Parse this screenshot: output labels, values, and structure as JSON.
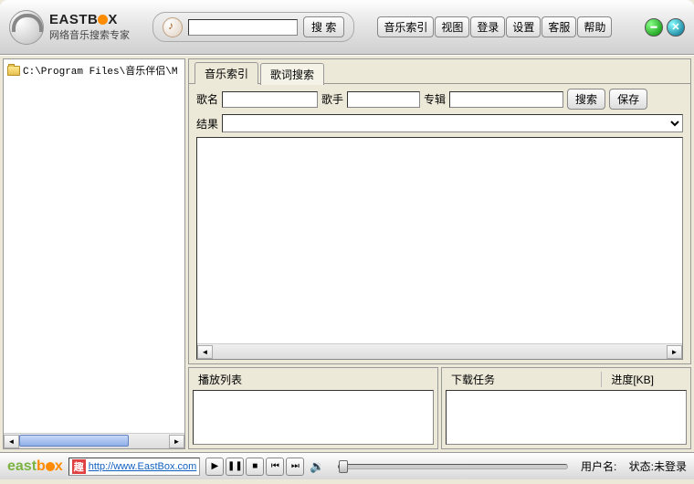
{
  "header": {
    "brand_prefix": "EASTB",
    "brand_suffix": "X",
    "subtitle": "网络音乐搜索专家",
    "search_button": "搜 索",
    "nav": [
      "音乐索引",
      "视图",
      "登录",
      "设置",
      "客服",
      "帮助"
    ]
  },
  "sidebar": {
    "path": "C:\\Program Files\\音乐伴侣\\M"
  },
  "tabs": {
    "items": [
      "音乐索引",
      "歌词搜索"
    ],
    "active": 1
  },
  "search_fields": {
    "song_label": "歌名",
    "singer_label": "歌手",
    "album_label": "专辑",
    "search_btn": "搜索",
    "save_btn": "保存",
    "result_label": "结果"
  },
  "panels": {
    "playlist": "播放列表",
    "download": "下载任务",
    "progress": "进度[KB]"
  },
  "footer": {
    "qu_label": "趣",
    "url": "http://www.EastBox.com",
    "user_label": "用户名:",
    "status_label": "状态:未登录"
  }
}
